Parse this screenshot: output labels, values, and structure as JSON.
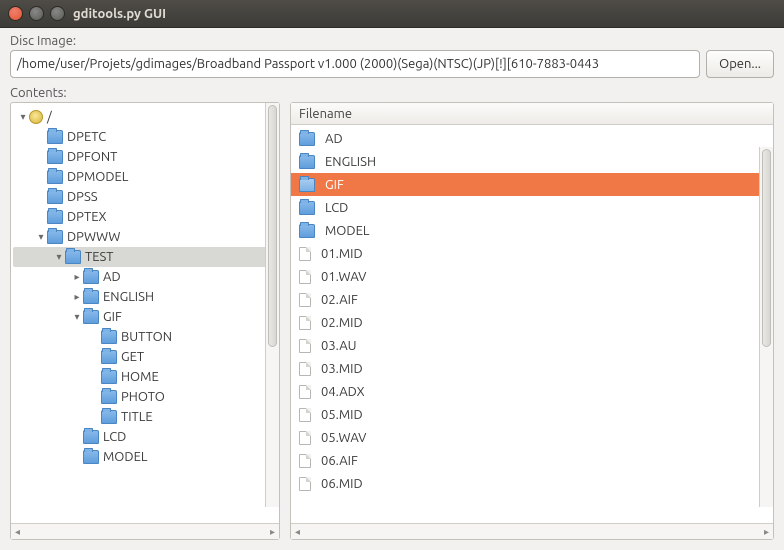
{
  "window": {
    "title": "gditools.py GUI"
  },
  "disc_image": {
    "label": "Disc Image:",
    "value": "/home/user/Projets/gdimages/Broadband Passport v1.000 (2000)(Sega)(NTSC)(JP)[!][610-7883-0443",
    "open_label": "Open..."
  },
  "contents": {
    "label": "Contents:"
  },
  "tree": [
    {
      "depth": 0,
      "arrow": "down",
      "icon": "disc",
      "label": "/",
      "selected": false
    },
    {
      "depth": 1,
      "arrow": "",
      "icon": "folder",
      "label": "DPETC",
      "selected": false
    },
    {
      "depth": 1,
      "arrow": "",
      "icon": "folder",
      "label": "DPFONT",
      "selected": false
    },
    {
      "depth": 1,
      "arrow": "",
      "icon": "folder",
      "label": "DPMODEL",
      "selected": false
    },
    {
      "depth": 1,
      "arrow": "",
      "icon": "folder",
      "label": "DPSS",
      "selected": false
    },
    {
      "depth": 1,
      "arrow": "",
      "icon": "folder",
      "label": "DPTEX",
      "selected": false
    },
    {
      "depth": 1,
      "arrow": "down",
      "icon": "folder",
      "label": "DPWWW",
      "selected": false
    },
    {
      "depth": 2,
      "arrow": "down",
      "icon": "folder",
      "label": "TEST",
      "selected": true
    },
    {
      "depth": 3,
      "arrow": "right",
      "icon": "folder",
      "label": "AD",
      "selected": false
    },
    {
      "depth": 3,
      "arrow": "right",
      "icon": "folder",
      "label": "ENGLISH",
      "selected": false
    },
    {
      "depth": 3,
      "arrow": "down",
      "icon": "folder",
      "label": "GIF",
      "selected": false
    },
    {
      "depth": 4,
      "arrow": "",
      "icon": "folder",
      "label": "BUTTON",
      "selected": false
    },
    {
      "depth": 4,
      "arrow": "",
      "icon": "folder",
      "label": "GET",
      "selected": false
    },
    {
      "depth": 4,
      "arrow": "",
      "icon": "folder",
      "label": "HOME",
      "selected": false
    },
    {
      "depth": 4,
      "arrow": "",
      "icon": "folder",
      "label": "PHOTO",
      "selected": false
    },
    {
      "depth": 4,
      "arrow": "",
      "icon": "folder",
      "label": "TITLE",
      "selected": false
    },
    {
      "depth": 3,
      "arrow": "",
      "icon": "folder",
      "label": "LCD",
      "selected": false
    },
    {
      "depth": 3,
      "arrow": "",
      "icon": "folder",
      "label": "MODEL",
      "selected": false
    }
  ],
  "list_header": "Filename",
  "list": [
    {
      "icon": "folder",
      "name": "AD",
      "selected": false
    },
    {
      "icon": "folder",
      "name": "ENGLISH",
      "selected": false
    },
    {
      "icon": "folder",
      "name": "GIF",
      "selected": true
    },
    {
      "icon": "folder",
      "name": "LCD",
      "selected": false
    },
    {
      "icon": "folder",
      "name": "MODEL",
      "selected": false
    },
    {
      "icon": "file",
      "name": "01.MID",
      "selected": false
    },
    {
      "icon": "file",
      "name": "01.WAV",
      "selected": false
    },
    {
      "icon": "file",
      "name": "02.AIF",
      "selected": false
    },
    {
      "icon": "file",
      "name": "02.MID",
      "selected": false
    },
    {
      "icon": "file",
      "name": "03.AU",
      "selected": false
    },
    {
      "icon": "file",
      "name": "03.MID",
      "selected": false
    },
    {
      "icon": "file",
      "name": "04.ADX",
      "selected": false
    },
    {
      "icon": "file",
      "name": "05.MID",
      "selected": false
    },
    {
      "icon": "file",
      "name": "05.WAV",
      "selected": false
    },
    {
      "icon": "file",
      "name": "06.AIF",
      "selected": false
    },
    {
      "icon": "file",
      "name": "06.MID",
      "selected": false
    }
  ]
}
